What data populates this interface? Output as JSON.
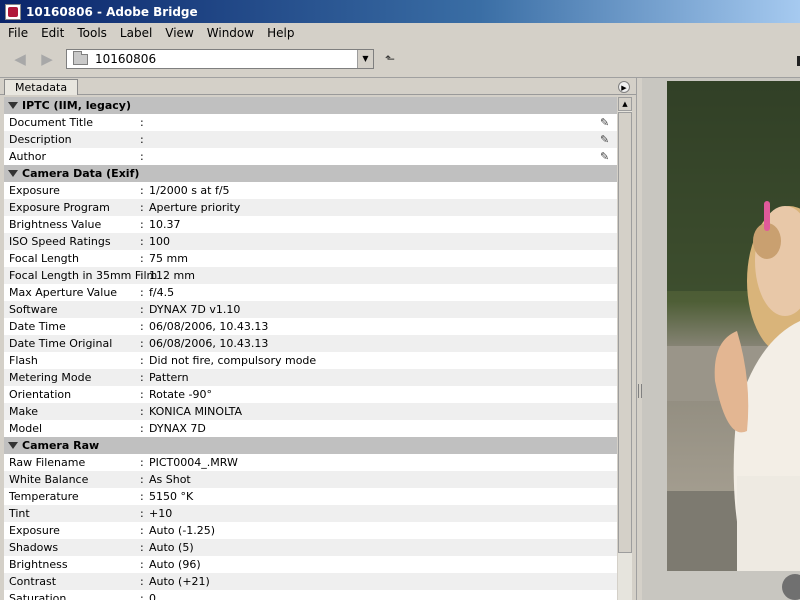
{
  "window": {
    "title": "10160806 - Adobe Bridge"
  },
  "menu": [
    "File",
    "Edit",
    "Tools",
    "Label",
    "View",
    "Window",
    "Help"
  ],
  "toolbar": {
    "path": "10160806",
    "back_icon": "back-arrow-icon",
    "forward_icon": "forward-arrow-icon",
    "up_icon": "up-folder-icon"
  },
  "panel": {
    "tab_label": "Metadata"
  },
  "sections": [
    {
      "title": "IPTC (IIM, legacy)",
      "rows": [
        {
          "label": "Document Title",
          "value": "",
          "editable": true
        },
        {
          "label": "Description",
          "value": "",
          "editable": true
        },
        {
          "label": "Author",
          "value": "",
          "editable": true
        }
      ]
    },
    {
      "title": "Camera Data (Exif)",
      "rows": [
        {
          "label": "Exposure",
          "value": "1/2000 s at f/5"
        },
        {
          "label": "Exposure Program",
          "value": "Aperture priority"
        },
        {
          "label": "Brightness Value",
          "value": "10.37"
        },
        {
          "label": "ISO Speed Ratings",
          "value": "100"
        },
        {
          "label": "Focal Length",
          "value": "75 mm"
        },
        {
          "label": "Focal Length in 35mm Film",
          "value": "112 mm"
        },
        {
          "label": "Max Aperture Value",
          "value": "f/4.5"
        },
        {
          "label": "Software",
          "value": "DYNAX 7D v1.10"
        },
        {
          "label": "Date Time",
          "value": "06/08/2006, 10.43.13"
        },
        {
          "label": "Date Time Original",
          "value": "06/08/2006, 10.43.13"
        },
        {
          "label": "Flash",
          "value": "Did not fire, compulsory mode"
        },
        {
          "label": "Metering Mode",
          "value": "Pattern"
        },
        {
          "label": "Orientation",
          "value": "Rotate -90°"
        },
        {
          "label": "Make",
          "value": "KONICA MINOLTA"
        },
        {
          "label": "Model",
          "value": "DYNAX 7D"
        }
      ]
    },
    {
      "title": "Camera Raw",
      "rows": [
        {
          "label": "Raw Filename",
          "value": "PICT0004_.MRW"
        },
        {
          "label": "White Balance",
          "value": "As Shot"
        },
        {
          "label": "Temperature",
          "value": "5150 °K"
        },
        {
          "label": "Tint",
          "value": "+10"
        },
        {
          "label": "Exposure",
          "value": "Auto (-1.25)"
        },
        {
          "label": "Shadows",
          "value": "Auto (5)"
        },
        {
          "label": "Brightness",
          "value": "Auto (96)"
        },
        {
          "label": "Contrast",
          "value": "Auto (+21)"
        },
        {
          "label": "Saturation",
          "value": "0"
        }
      ]
    }
  ],
  "colors": {
    "title_start": "#0a246a",
    "title_end": "#a6caf0",
    "section_bg": "#c0c0c0",
    "row_alt": "#efefef"
  }
}
